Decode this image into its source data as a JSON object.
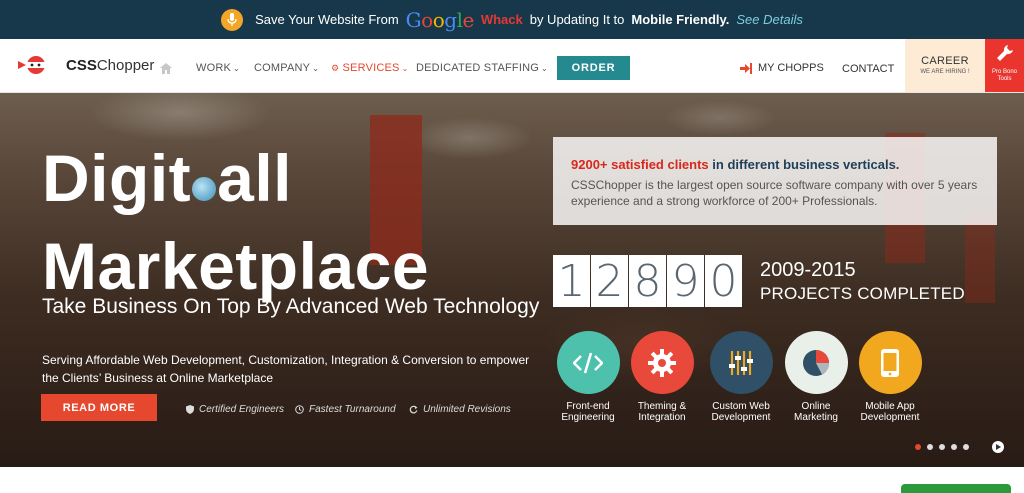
{
  "banner": {
    "prefix": "Save Your Website From",
    "google": "Google",
    "whack": "Whack",
    "middle": "by Updating It to",
    "bold": "Mobile Friendly.",
    "link": "See Details"
  },
  "nav": {
    "logo_bold": "CSS",
    "logo_rest": "Chopper",
    "items": [
      {
        "label": "WORK"
      },
      {
        "label": "COMPANY"
      },
      {
        "label": "SERVICES"
      },
      {
        "label": "DEDICATED STAFFING"
      }
    ],
    "order": "ORDER",
    "my_chopps": "MY CHOPPS",
    "contact": "CONTACT",
    "career": "CAREER",
    "career_sub": "WE ARE HIRING !",
    "probono_line1": "Pro Bono",
    "probono_line2": "Tools"
  },
  "hero": {
    "line1_a": "Digit",
    "line1_b": "all",
    "line2": "Marketplace",
    "subtitle": "Take Business On Top By Advanced Web Technology",
    "desc": "Serving Affordable Web Development, Customization, Integration & Conversion to empower the Clients’ Business at Online Marketplace",
    "readmore": "READ MORE",
    "features": [
      "Certified Engineers",
      "Fastest Turnaround",
      "Unlimited Revisions"
    ],
    "info_count": "9200+ satisfied clients",
    "info_rest": "in different business verticals.",
    "info_para": "CSSChopper is the largest open source software company with over 5 years experience and a strong workforce of 200+ Professionals.",
    "digits": [
      "1",
      "2",
      "8",
      "9",
      "0"
    ],
    "years": "2009-2015",
    "projects": "PROJECTS COMPLETED",
    "services": [
      {
        "line1": "Front-end",
        "line2": "Engineering",
        "color": "#4ec1ac"
      },
      {
        "line1": "Theming &",
        "line2": "Integration",
        "color": "#e8493a"
      },
      {
        "line1": "Custom Web",
        "line2": "Development",
        "color": "#2f5066"
      },
      {
        "line1": "Online",
        "line2": "Marketing",
        "color": "#e9efe9"
      },
      {
        "line1": "Mobile App",
        "line2": "Development",
        "color": "#f2a81e"
      }
    ]
  },
  "colors": {
    "accent_red": "#e5482e",
    "teal": "#248a8f",
    "banner_bg": "#17384a"
  }
}
